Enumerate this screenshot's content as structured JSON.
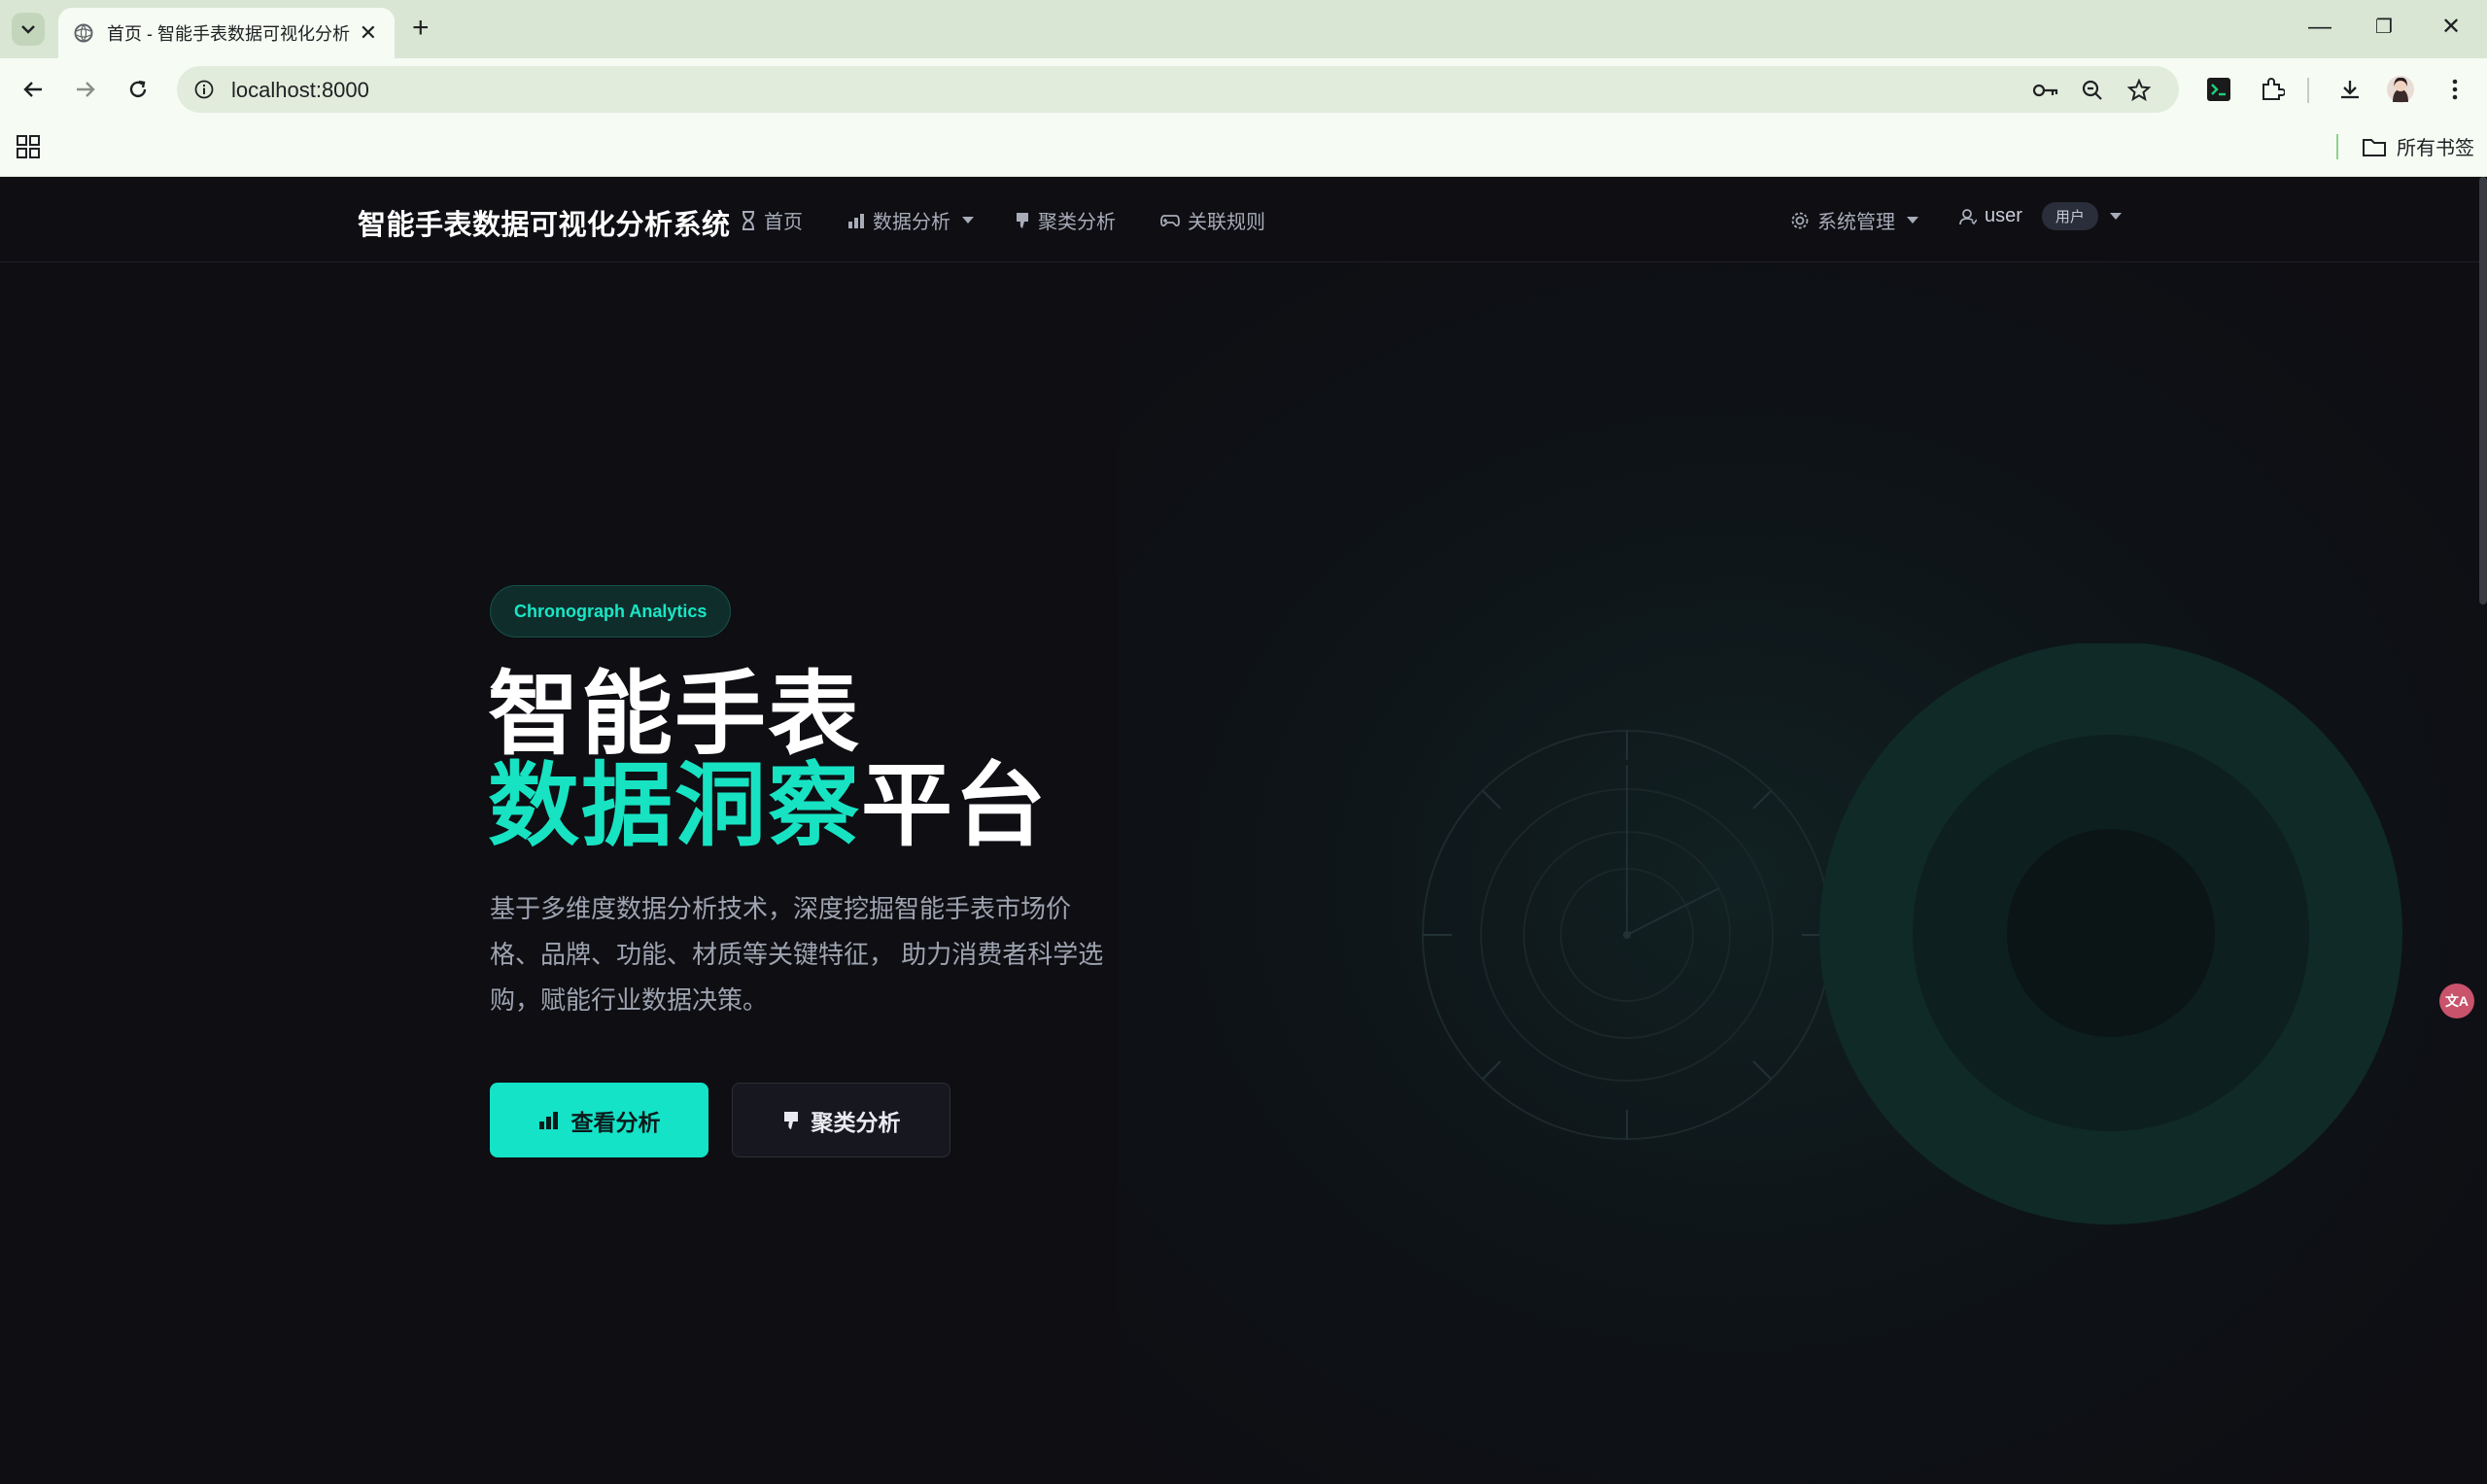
{
  "browser": {
    "tab_title": "首页 - 智能手表数据可视化分析",
    "tab_close": "✕",
    "new_tab": "+",
    "url": "localhost:8000",
    "window_controls": {
      "minimize": "—",
      "maximize": "❐",
      "close": "✕"
    },
    "bookmarks_label": "所有书签"
  },
  "site": {
    "brand": "智能手表数据可视化分析系统",
    "nav": {
      "home": "首页",
      "data_analysis": "数据分析",
      "cluster_analysis": "聚类分析",
      "association_rules": "关联规则",
      "system_admin": "系统管理",
      "user_name": "user",
      "user_role": "用户"
    },
    "hero": {
      "badge": "Chronograph Analytics",
      "title_line1": "智能手表",
      "title_accent": "数据洞察",
      "title_rest": "平台",
      "description": "基于多维度数据分析技术，深度挖掘智能手表市场价格、品牌、功能、材质等关键特征， 助力消费者科学选购，赋能行业数据决策。",
      "btn_primary": "查看分析",
      "btn_secondary": "聚类分析"
    }
  },
  "colors": {
    "accent": "#17e3c3",
    "background": "#0e0e13",
    "chrome": "#d9e6d3"
  }
}
